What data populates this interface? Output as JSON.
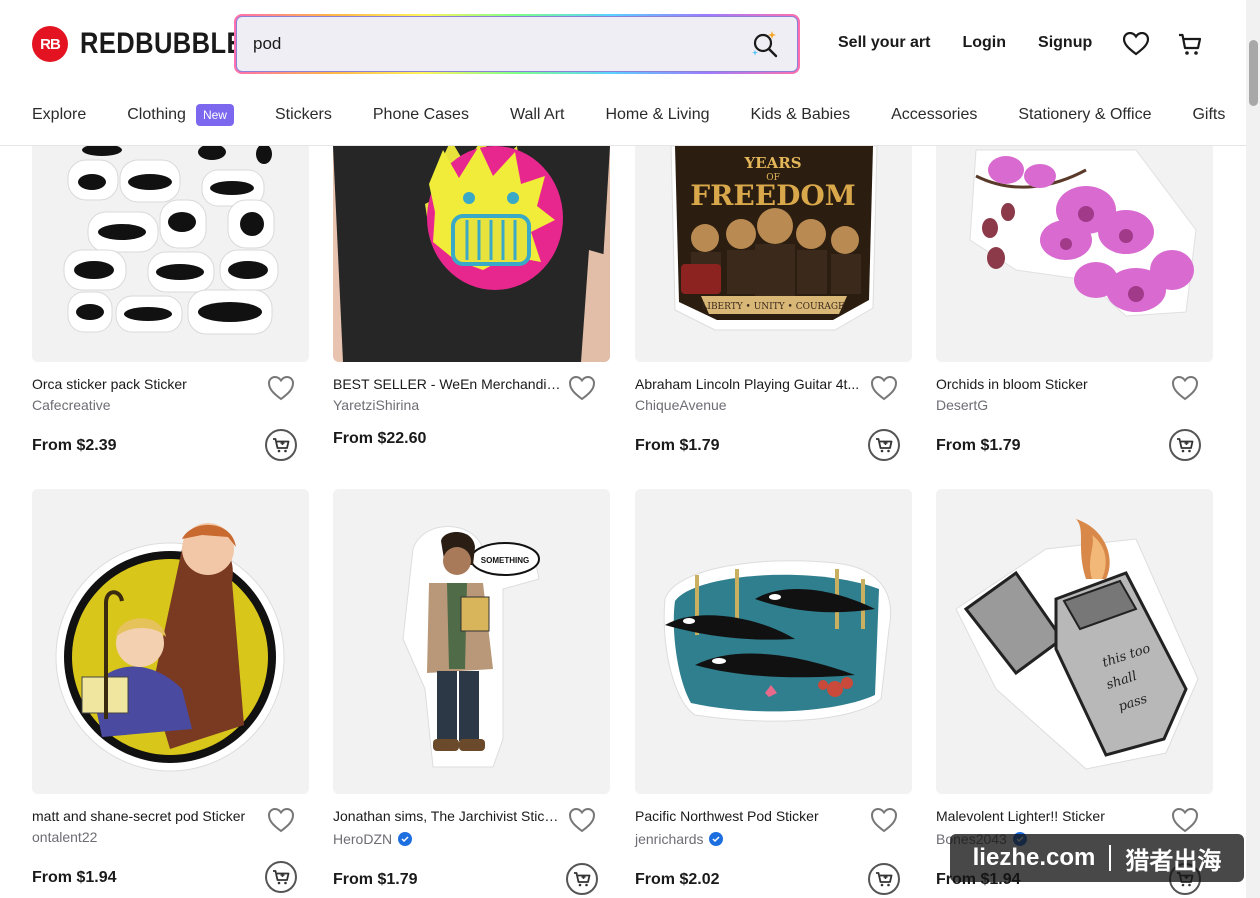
{
  "logo": {
    "mark": "RB",
    "text": "REDBUBBLE"
  },
  "search": {
    "value": "pod"
  },
  "top_links": [
    "Sell your art",
    "Login",
    "Signup"
  ],
  "nav": {
    "items": [
      "Explore",
      "Clothing",
      "Stickers",
      "Phone Cases",
      "Wall Art",
      "Home & Living",
      "Kids & Babies",
      "Accessories",
      "Stationery & Office",
      "Gifts"
    ],
    "new_badge": "New"
  },
  "products": [
    {
      "title": "Orca sticker pack Sticker",
      "artist": "Cafecreative",
      "price": "From $2.39",
      "verified": false
    },
    {
      "title": "BEST SELLER - WeEn Merchandise...",
      "artist": "YaretziShirina",
      "price": "From $22.60",
      "verified": false
    },
    {
      "title": "Abraham Lincoln Playing Guitar 4t...",
      "artist": "ChiqueAvenue",
      "price": "From $1.79",
      "verified": false
    },
    {
      "title": "Orchids in bloom Sticker",
      "artist": "DesertG",
      "price": "From $1.79",
      "verified": false
    },
    {
      "title": "matt and shane-secret pod Sticker",
      "artist": "ontalent22",
      "price": "From $1.94",
      "verified": false
    },
    {
      "title": "Jonathan sims, The Jarchivist Sticker",
      "artist": "HeroDZN",
      "price": "From $1.79",
      "verified": true
    },
    {
      "title": "Pacific Northwest Pod Sticker",
      "artist": "jenrichards",
      "price": "From $2.02",
      "verified": true
    },
    {
      "title": "Malevolent Lighter!! Sticker",
      "artist": "Bones2043",
      "price": "From $1.94",
      "verified": true
    }
  ],
  "image_texts": {
    "freedom_years": "YEARS",
    "freedom_of": "OF",
    "freedom_word": "FREEDOM",
    "freedom_motto": "LIBERTY • UNITY • COURAGE",
    "speech_bubble": "SOMETHING",
    "lighter_line1": "this too",
    "lighter_line2": "shall",
    "lighter_line3": "pass"
  },
  "watermark": {
    "left": "liezhe.com",
    "right": "猎者出海"
  },
  "colors": {
    "brand_red": "#e41321",
    "badge_purple": "#7b68ee",
    "verified_blue": "#1d6fe0"
  }
}
